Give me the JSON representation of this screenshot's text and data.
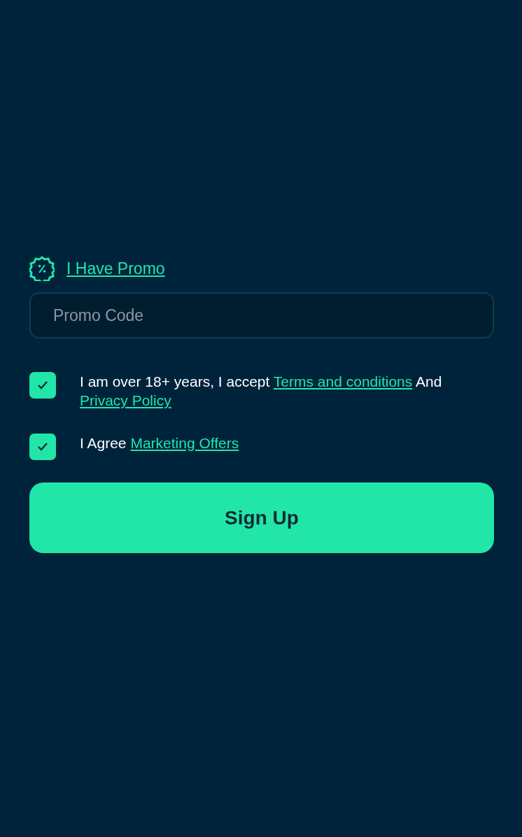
{
  "promo_toggle": {
    "label": "I Have Promo"
  },
  "promo_field": {
    "placeholder": "Promo Code"
  },
  "consents": [
    {
      "checked": true,
      "parts": [
        {
          "kind": "text",
          "text": "I am over 18+ years, I accept "
        },
        {
          "kind": "link",
          "text": "Terms and conditions"
        },
        {
          "kind": "text",
          "text": " And "
        },
        {
          "kind": "link",
          "text": "Privacy Policy"
        }
      ]
    },
    {
      "checked": true,
      "parts": [
        {
          "kind": "text",
          "text": "I Agree "
        },
        {
          "kind": "link",
          "text": "Marketing Offers"
        }
      ]
    }
  ],
  "submit": {
    "label": "Sign Up"
  }
}
